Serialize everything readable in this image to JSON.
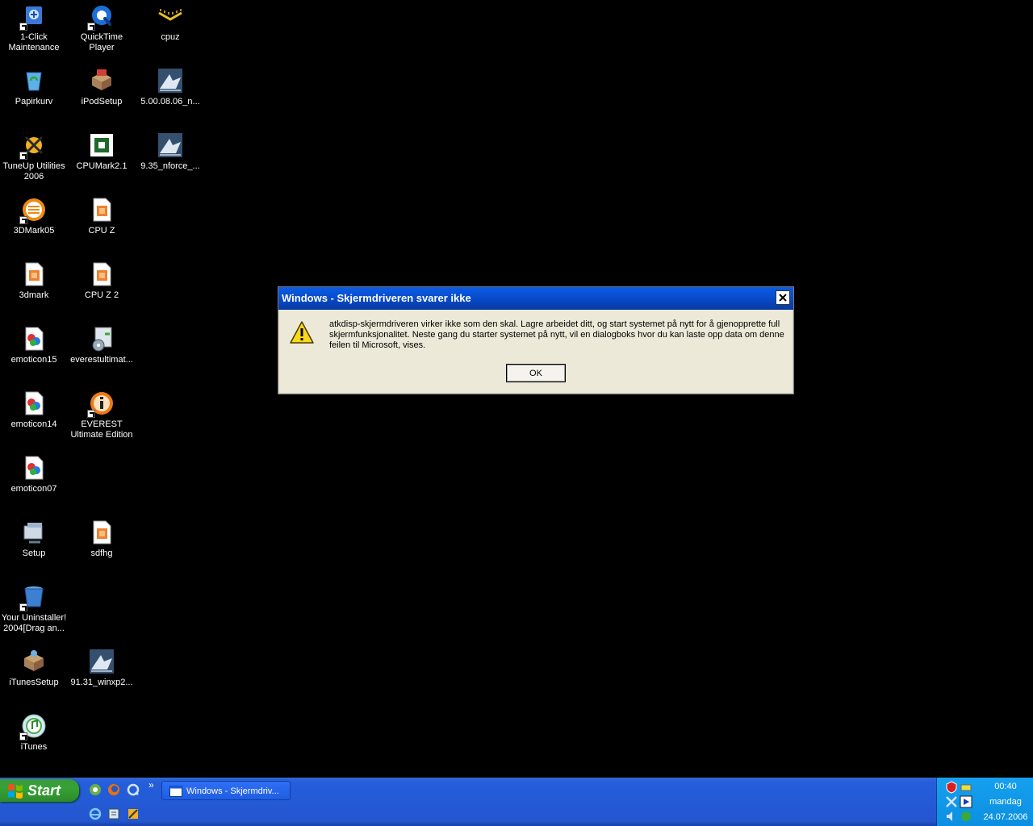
{
  "desktop": {
    "icons": [
      {
        "label": "1-Click\nMaintenance",
        "icon": "maintenance-icon"
      },
      {
        "label": "QuickTime Player",
        "icon": "quicktime-icon"
      },
      {
        "label": "cpuz",
        "icon": "cpuz-icon"
      },
      {
        "label": "Papirkurv",
        "icon": "recycle-bin-icon"
      },
      {
        "label": "iPodSetup",
        "icon": "installer-box-icon"
      },
      {
        "label": "5.00.08.06_n...",
        "icon": "nvidia-installer-icon"
      },
      {
        "label": "TuneUp Utilities\n2006",
        "icon": "tuneup-icon"
      },
      {
        "label": "CPUMark2.1",
        "icon": "cpumark-icon"
      },
      {
        "label": "9.35_nforce_...",
        "icon": "nforce-installer-icon"
      },
      {
        "label": "3DMark05",
        "icon": "3dmark05-icon"
      },
      {
        "label": "CPU Z",
        "icon": "image-file-icon"
      },
      {
        "label": "3dmark",
        "icon": "image-file-icon"
      },
      {
        "label": "CPU Z 2",
        "icon": "image-file-icon"
      },
      {
        "label": "emoticon15",
        "icon": "image-file-icon"
      },
      {
        "label": "everestultimat...",
        "icon": "everest-setup-icon"
      },
      {
        "label": "emoticon14",
        "icon": "image-file-icon"
      },
      {
        "label": "EVEREST\nUltimate Edition",
        "icon": "everest-icon"
      },
      {
        "label": "emoticon07",
        "icon": "image-file-icon"
      },
      {
        "label": "Setup",
        "icon": "setup-icon"
      },
      {
        "label": "sdfhg",
        "icon": "image-file-icon"
      },
      {
        "label": "Your Uninstaller!\n2004[Drag an...",
        "icon": "uninstaller-icon"
      },
      {
        "label": "iTunesSetup",
        "icon": "installer-box-icon"
      },
      {
        "label": "91.31_winxp2...",
        "icon": "nvidia-installer-icon"
      },
      {
        "label": "iTunes",
        "icon": "itunes-icon"
      }
    ]
  },
  "dialog": {
    "title": "Windows - Skjermdriveren svarer ikke",
    "message": "atkdisp-skjermdriveren virker ikke som den skal. Lagre arbeidet ditt, og start systemet på nytt for å gjenopprette full skjermfunksjonalitet. Neste gang du starter systemet på nytt, vil en dialogboks hvor du kan laste opp data om denne feilen til Microsoft, vises.",
    "ok_label": "OK",
    "icon": "warning-icon",
    "close_icon": "close-icon"
  },
  "taskbar": {
    "start_label": "Start",
    "task_button_label": "Windows - Skjermdriv...",
    "quicklaunch_more": "»",
    "clock_time": "00:40",
    "clock_day": "mandag",
    "clock_date": "24.07.2006"
  },
  "colors": {
    "titlebar": "#0a5ce6",
    "taskbar": "#245edb",
    "start": "#35a235",
    "tray": "#0c8fe0",
    "dialog_bg": "#ece9d8"
  }
}
